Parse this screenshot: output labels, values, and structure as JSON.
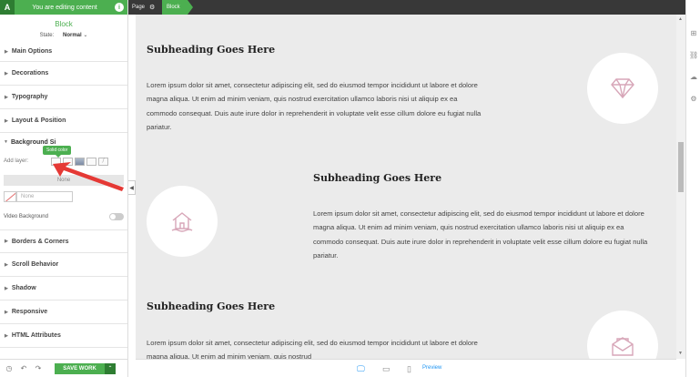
{
  "sidebar": {
    "logo": "A",
    "editing_banner": "You are editing content",
    "info_icon": "i",
    "block_title": "Block",
    "state_label": "State:",
    "state_value": "Normal",
    "sections_top": [
      "Main Options",
      "Decorations",
      "Typography",
      "Layout & Position"
    ],
    "background": {
      "heading": "Background Si",
      "add_layer_label": "Add layer:",
      "tooltip": "Solid color",
      "none_label": "None",
      "color_placeholder": "None",
      "video_background": "Video Background"
    },
    "sections_bottom": [
      "Borders & Corners",
      "Scroll Behavior",
      "Shadow",
      "Responsive",
      "HTML Attributes"
    ],
    "footer": {
      "save_label": "SAVE WORK"
    }
  },
  "topbar": {
    "crumb_page": "Page",
    "crumb_block": "Block"
  },
  "content": {
    "sections": [
      {
        "heading": "Subheading Goes Here",
        "text": "Lorem ipsum dolor sit amet, consectetur adipiscing elit, sed do eiusmod tempor incididunt ut labore et dolore magna aliqua. Ut enim ad minim veniam, quis nostrud exercitation ullamco laboris nisi ut aliquip ex ea commodo consequat. Duis aute irure dolor in reprehenderit in voluptate velit esse cillum dolore eu fugiat nulla pariatur.",
        "icon": "diamond-icon"
      },
      {
        "heading": "Subheading Goes Here",
        "text": "Lorem ipsum dolor sit amet, consectetur adipiscing elit, sed do eiusmod tempor incididunt ut labore et dolore magna aliqua. Ut enim ad minim veniam, quis nostrud exercitation ullamco laboris nisi ut aliquip ex ea commodo consequat. Duis aute irure dolor in reprehenderit in voluptate velit esse cillum dolore eu fugiat nulla pariatur.",
        "icon": "house-icon"
      },
      {
        "heading": "Subheading Goes Here",
        "text": "Lorem ipsum dolor sit amet, consectetur adipiscing elit, sed do eiusmod tempor incididunt ut labore et dolore magna aliqua. Ut enim ad minim veniam, quis nostrud",
        "icon": "envelope-icon"
      }
    ]
  },
  "bottom_bar": {
    "preview_label": "Preview"
  },
  "colors": {
    "accent": "#4caf50",
    "accent_dark": "#2e7d32",
    "icon_pink": "#d7a6b8",
    "canvas_bg": "#ebebeb",
    "topbar_bg": "#383838",
    "preview_blue": "#2196f3",
    "arrow_red": "#e53935"
  },
  "right_rail_icons": [
    "add-element-icon",
    "link-icon",
    "cloud-icon",
    "settings-icon"
  ]
}
